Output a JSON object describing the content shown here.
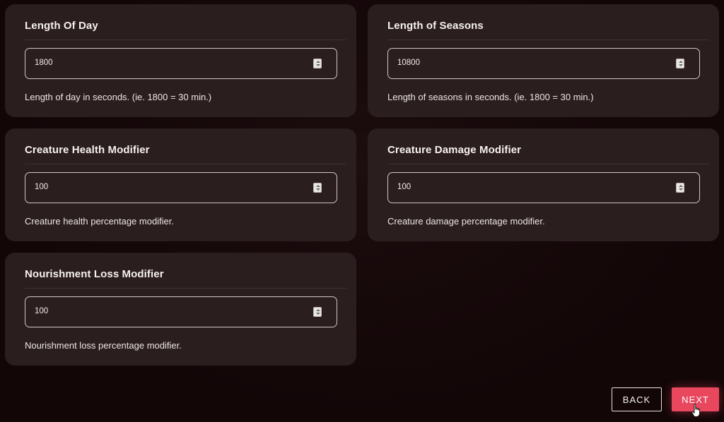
{
  "settings": [
    {
      "title": "Length Of Day",
      "value": "1800",
      "description": "Length of day in seconds. (ie. 1800 = 30 min.)"
    },
    {
      "title": "Length of Seasons",
      "value": "10800",
      "description": "Length of seasons in seconds. (ie. 1800 = 30 min.)"
    },
    {
      "title": "Creature Health Modifier",
      "value": "100",
      "description": "Creature health percentage modifier."
    },
    {
      "title": "Creature Damage Modifier",
      "value": "100",
      "description": "Creature damage percentage modifier."
    },
    {
      "title": "Nourishment Loss Modifier",
      "value": "100",
      "description": "Nourishment loss percentage modifier."
    }
  ],
  "buttons": {
    "back_label": "BACK",
    "next_label": "NEXT"
  },
  "colors": {
    "background": "#130708",
    "card": "#2b1e1e",
    "accent": "#e8475e"
  }
}
